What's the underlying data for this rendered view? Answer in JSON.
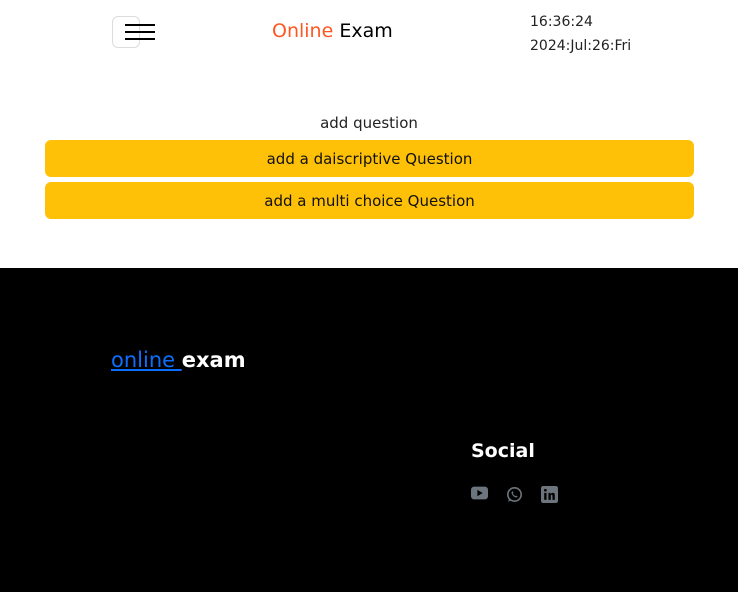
{
  "header": {
    "brand_accent": "Online",
    "brand_rest": " Exam",
    "time": "16:36:24",
    "date": "2024:Jul:26:Fri"
  },
  "main": {
    "section_label": "add question",
    "buttons": [
      {
        "label": "add a daiscriptive Question"
      },
      {
        "label": "add a multi choice Question"
      }
    ]
  },
  "footer": {
    "brand_link": "online ",
    "brand_rest": "exam",
    "social_title": "Social",
    "social_icons": [
      "youtube-icon",
      "whatsapp-icon",
      "linkedin-icon"
    ]
  },
  "colors": {
    "accent": "#ff5722",
    "button": "#ffc107",
    "footer_bg": "#000000",
    "link": "#0d6efd",
    "icon": "#6c757d"
  }
}
